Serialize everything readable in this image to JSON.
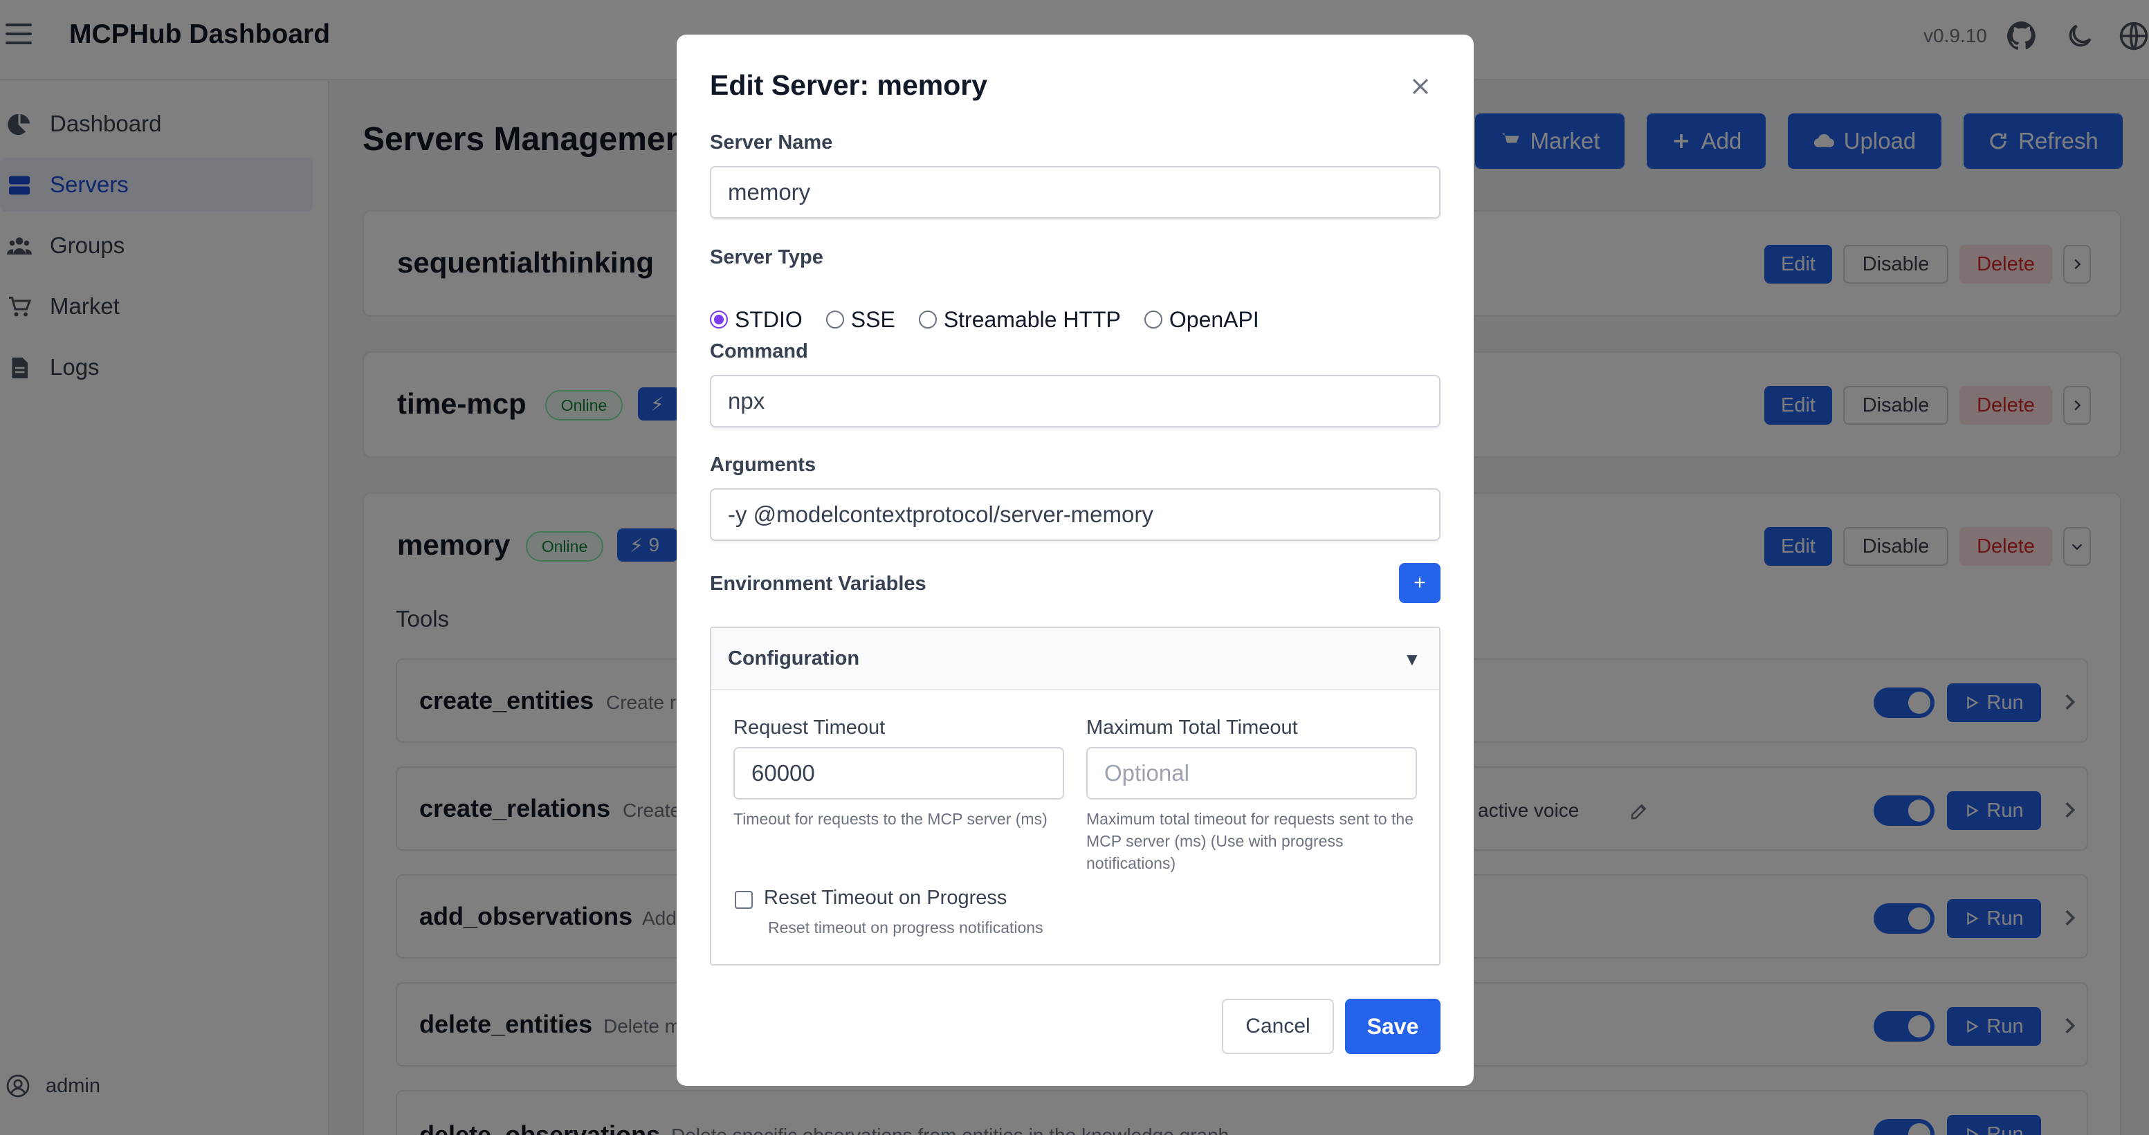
{
  "header": {
    "title": "MCPHub Dashboard",
    "version": "v0.9.10",
    "icons": [
      "menu-icon",
      "github-icon",
      "moon-icon",
      "globe-icon"
    ]
  },
  "sidebar": {
    "items": [
      {
        "label": "Dashboard",
        "icon": "dashboard-icon",
        "active": false
      },
      {
        "label": "Servers",
        "icon": "servers-icon",
        "active": true
      },
      {
        "label": "Groups",
        "icon": "groups-icon",
        "active": false
      },
      {
        "label": "Market",
        "icon": "cart-icon",
        "active": false
      },
      {
        "label": "Logs",
        "icon": "document-icon",
        "active": false
      }
    ],
    "user": "admin"
  },
  "main": {
    "title": "Servers Management",
    "toolbar": {
      "market": "Market",
      "add": "Add",
      "upload": "Upload",
      "refresh": "Refresh"
    },
    "actions": {
      "edit": "Edit",
      "disable": "Disable",
      "delete": "Delete"
    },
    "servers": [
      {
        "name": "sequentialthinking"
      },
      {
        "name": "time-mcp",
        "status": "Online"
      },
      {
        "name": "memory",
        "status": "Online",
        "tools_badge": "9"
      }
    ],
    "tools_label": "Tools",
    "tools": [
      {
        "name": "create_entities",
        "desc": "Create r"
      },
      {
        "name": "create_relations",
        "desc": "Create",
        "desc_tail": "active voice"
      },
      {
        "name": "add_observations",
        "desc": "Add"
      },
      {
        "name": "delete_entities",
        "desc": "Delete m"
      },
      {
        "name": "delete_observations",
        "desc": "Delete specific observations from entities in the knowledge graph"
      }
    ],
    "run_label": "Run"
  },
  "modal": {
    "title": "Edit Server: memory",
    "server_name_label": "Server Name",
    "server_name_value": "memory",
    "server_type_label": "Server Type",
    "server_types": [
      "STDIO",
      "SSE",
      "Streamable HTTP",
      "OpenAPI"
    ],
    "selected_type": "STDIO",
    "command_label": "Command",
    "command_value": "npx",
    "arguments_label": "Arguments",
    "arguments_value": "-y @modelcontextprotocol/server-memory",
    "env_label": "Environment Variables",
    "env_add": "+",
    "config": {
      "title": "Configuration",
      "caret": "▼",
      "request_timeout_label": "Request Timeout",
      "request_timeout_value": "60000",
      "request_timeout_help": "Timeout for requests to the MCP server (ms)",
      "max_timeout_label": "Maximum Total Timeout",
      "max_timeout_placeholder": "Optional",
      "max_timeout_help": "Maximum total timeout for requests sent to the MCP server (ms) (Use with progress notifications)",
      "reset_label": "Reset Timeout on Progress",
      "reset_help": "Reset timeout on progress notifications"
    },
    "cancel": "Cancel",
    "save": "Save"
  },
  "colors": {
    "primary": "#2563eb",
    "danger": "#dc2626",
    "success": "#15803d",
    "radio_accent": "#7c3aed"
  }
}
